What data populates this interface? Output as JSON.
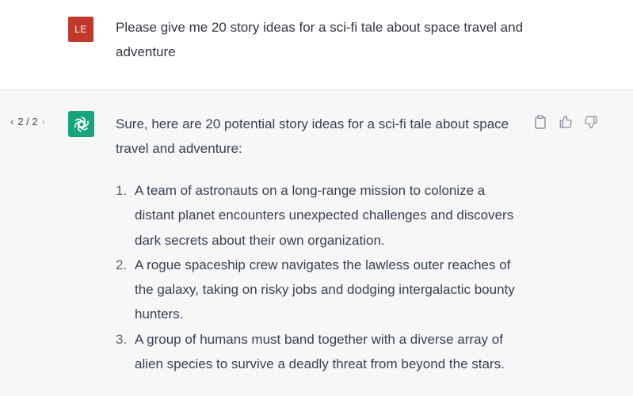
{
  "user_message": {
    "avatar_initials": "LE",
    "text": "Please give me 20 story ideas for a sci-fi tale about space travel and adventure"
  },
  "assistant_message": {
    "pager": {
      "prev": "‹",
      "label": "2 / 2",
      "next": "›"
    },
    "avatar_icon": "openai-logo-icon",
    "intro": "Sure, here are 20 potential story ideas for a sci-fi tale about space travel and adventure:",
    "ideas": [
      {
        "number": "1.",
        "text": "A team of astronauts on a long-range mission to colonize a distant planet encounters unexpected challenges and discovers dark secrets about their own organization."
      },
      {
        "number": "2.",
        "text": "A rogue spaceship crew navigates the lawless outer reaches of the galaxy, taking on risky jobs and dodging intergalactic bounty hunters."
      },
      {
        "number": "3.",
        "text": "A group of humans must band together with a diverse array of alien species to survive a deadly threat from beyond the stars."
      }
    ],
    "actions": [
      "clipboard-icon",
      "thumbs-up-icon",
      "thumbs-down-icon"
    ]
  },
  "colors": {
    "user_avatar": "#c0392b",
    "bot_avatar": "#19a37f",
    "assistant_bg": "#f7f7f8"
  }
}
